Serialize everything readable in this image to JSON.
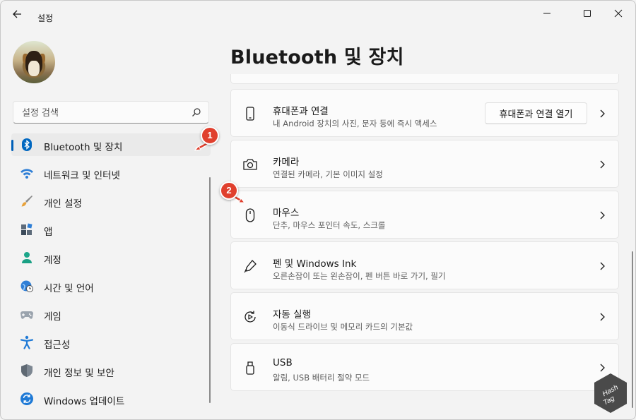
{
  "window": {
    "title": "설정"
  },
  "search": {
    "placeholder": "설정 검색"
  },
  "sidebar": {
    "items": [
      {
        "label": "Bluetooth 및 장치",
        "icon": "bluetooth-icon",
        "active": true
      },
      {
        "label": "네트워크 및 인터넷",
        "icon": "wifi-icon"
      },
      {
        "label": "개인 설정",
        "icon": "brush-icon"
      },
      {
        "label": "앱",
        "icon": "apps-icon"
      },
      {
        "label": "계정",
        "icon": "account-icon"
      },
      {
        "label": "시간 및 언어",
        "icon": "globe-clock-icon"
      },
      {
        "label": "게임",
        "icon": "gamepad-icon"
      },
      {
        "label": "접근성",
        "icon": "accessibility-icon"
      },
      {
        "label": "개인 정보 및 보안",
        "icon": "shield-icon"
      },
      {
        "label": "Windows 업데이트",
        "icon": "update-icon"
      }
    ]
  },
  "main": {
    "title": "Bluetooth 및 장치",
    "cards": [
      {
        "title": "휴대폰과 연결",
        "subtitle": "내 Android 장치의 사진, 문자 등에 즉시 액세스",
        "button": "휴대폰과 연결 열기",
        "icon": "phone-icon"
      },
      {
        "title": "카메라",
        "subtitle": "연결된 카메라, 기본 이미지 설정",
        "icon": "camera-icon"
      },
      {
        "title": "마우스",
        "subtitle": "단추, 마우스 포인터 속도, 스크롤",
        "icon": "mouse-icon"
      },
      {
        "title": "펜 및 Windows Ink",
        "subtitle": "오른손잡이 또는 왼손잡이, 펜 버튼 바로 가기, 필기",
        "icon": "pen-icon"
      },
      {
        "title": "자동 실행",
        "subtitle": "이동식 드라이브 및 메모리 카드의 기본값",
        "icon": "autoplay-icon"
      },
      {
        "title": "USB",
        "subtitle": "알림, USB 배터리 절약 모드",
        "icon": "usb-icon"
      }
    ]
  },
  "annotations": {
    "badge1": "1",
    "badge2": "2"
  },
  "watermark": {
    "text": "Hash Tag"
  },
  "colors": {
    "accent": "#005fb8",
    "badge": "#e0402e",
    "background": "#f3f3f3",
    "card": "#fbfbfb"
  }
}
